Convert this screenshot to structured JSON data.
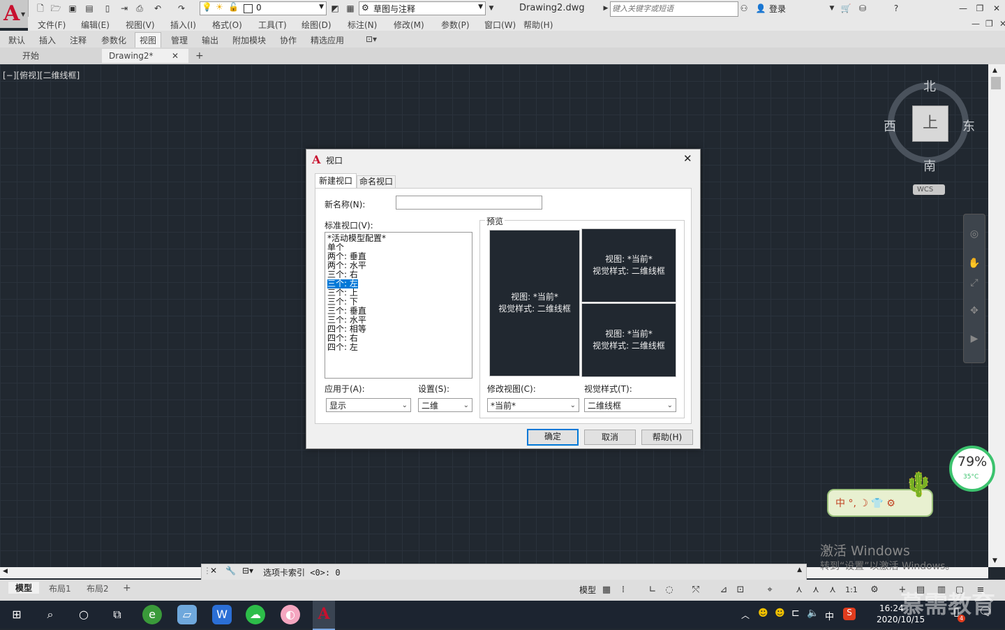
{
  "titlebar": {
    "layer_value": "0",
    "workspace": "草图与注释",
    "filename": "Drawing2.dwg",
    "search_placeholder": "键入关键字或短语",
    "signin": "登录"
  },
  "menus": [
    "文件(F)",
    "编辑(E)",
    "视图(V)",
    "插入(I)",
    "格式(O)",
    "工具(T)",
    "绘图(D)",
    "标注(N)",
    "修改(M)",
    "参数(P)",
    "窗口(W)",
    "帮助(H)"
  ],
  "ribbon_tabs": [
    "默认",
    "插入",
    "注释",
    "参数化",
    "视图",
    "管理",
    "输出",
    "附加模块",
    "协作",
    "精选应用"
  ],
  "ribbon_active": "视图",
  "doc_tabs": {
    "start": "开始",
    "drawing": "Drawing2*",
    "add": "+"
  },
  "viewport_label": "[−][俯视][二维线框]",
  "viewcube": {
    "north": "北",
    "south": "南",
    "east": "东",
    "west": "西",
    "face": "上",
    "wcs": "WCS"
  },
  "command_line": "选项卡索引 <0>: 0",
  "layout_tabs": [
    "模型",
    "布局1",
    "布局2"
  ],
  "status": {
    "model": "模型",
    "scale": "1:1"
  },
  "dialog": {
    "title": "视口",
    "tabs": [
      "新建视口",
      "命名视口"
    ],
    "new_name_label": "新名称(N):",
    "new_name_value": "",
    "standard_label": "标准视口(V):",
    "standard_items": [
      "*活动模型配置*",
      "单个",
      "两个: 垂直",
      "两个: 水平",
      "三个: 右",
      "三个: 左",
      "三个: 上",
      "三个: 下",
      "三个: 垂直",
      "三个: 水平",
      "四个: 相等",
      "四个: 右",
      "四个: 左"
    ],
    "selected_item": "三个: 左",
    "preview_label": "预览",
    "preview_view": "视图: *当前*",
    "preview_style": "视觉样式: 二维线框",
    "apply_label": "应用于(A):",
    "apply_value": "显示",
    "setup_label": "设置(S):",
    "setup_value": "二维",
    "change_view_label": "修改视图(C):",
    "change_view_value": "*当前*",
    "visual_style_label": "视觉样式(T):",
    "visual_style_value": "二维线框",
    "ok": "确定",
    "cancel": "取消",
    "help": "帮助(H)"
  },
  "overlay": {
    "activate1": "激活 Windows",
    "activate2": "转到“设置”以激活 Windows。",
    "gauge_pct": "79%",
    "gauge_temp": "35°C",
    "ime": "中 °, ☽ 👕 ⚙",
    "watermark": "慕需教育"
  },
  "taskbar": {
    "time": "16:24",
    "date": "2020/10/15",
    "ime_lang": "中",
    "badge": "4"
  }
}
